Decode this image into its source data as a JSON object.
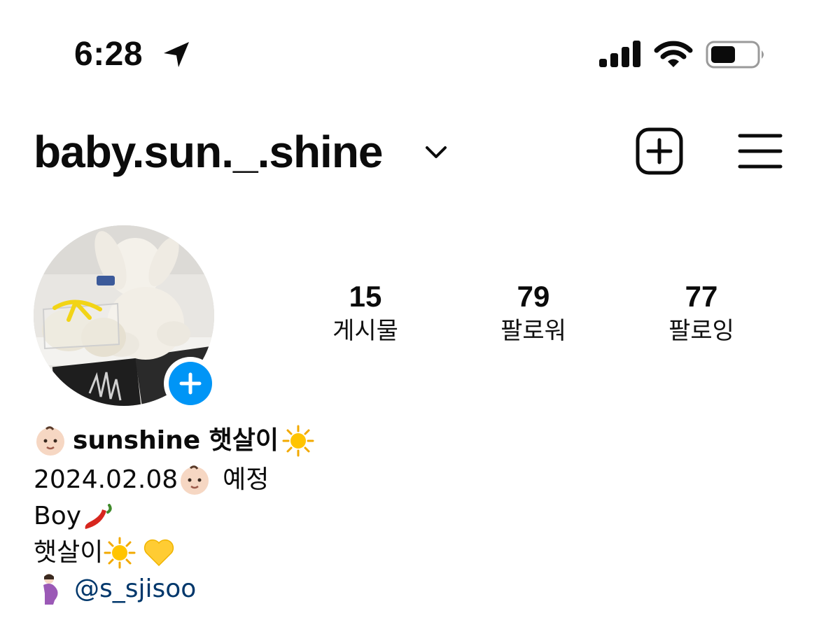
{
  "status_bar": {
    "time": "6:28"
  },
  "profile": {
    "username": "baby.sun._.shine",
    "stats": [
      {
        "value": "15",
        "label": "게시물"
      },
      {
        "value": "79",
        "label": "팔로워"
      },
      {
        "value": "77",
        "label": "팔로잉"
      }
    ]
  },
  "bio": {
    "name": "sunshine 햇살이",
    "line1": "2024.02.08",
    "line1_suffix": "예정",
    "line2": "Boy",
    "line3": "햇살이",
    "mention": "@s_sjisoo"
  },
  "icons": {
    "header": [
      "chevron-down-icon",
      "add-post-icon",
      "menu-icon"
    ],
    "status": [
      "location-arrow-icon",
      "cellular-signal-icon",
      "wifi-icon",
      "battery-icon"
    ],
    "bio_emoji": [
      "baby-face-icon",
      "sun-icon",
      "chili-pepper-icon",
      "yellow-heart-icon",
      "pregnant-woman-icon"
    ]
  },
  "colors": {
    "accent": "#0095f6",
    "link": "#00376b",
    "text": "#0b0b0b"
  }
}
